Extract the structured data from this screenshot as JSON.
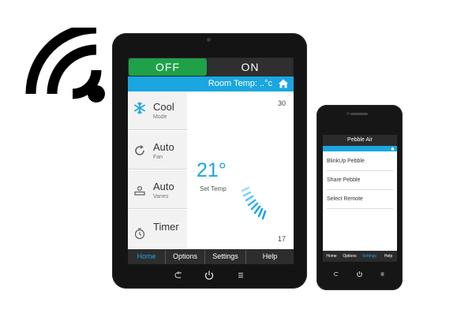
{
  "colors": {
    "accent": "#1aa6e0",
    "on_green": "#1fa14a",
    "device": "#141414"
  },
  "tablet": {
    "power": {
      "off_label": "OFF",
      "on_label": "ON"
    },
    "room_temp_label": "Room Temp:  ..°c",
    "modes": [
      {
        "icon": "snowflake-icon",
        "title": "Cool",
        "subtitle": "Mode"
      },
      {
        "icon": "fan-refresh-icon",
        "title": "Auto",
        "subtitle": "Fan"
      },
      {
        "icon": "vanes-icon",
        "title": "Auto",
        "subtitle": "Vanes"
      },
      {
        "icon": "clock-icon",
        "title": "Timer",
        "subtitle": ""
      }
    ],
    "set_temp_value": "21°",
    "set_temp_label": "Set Temp",
    "max_temp": "30",
    "min_temp": "17",
    "nav": [
      "Home",
      "Options",
      "Settings",
      "Help"
    ],
    "active_nav": "Home"
  },
  "phone": {
    "title": "Pebble Air",
    "menu": [
      "BlinkUp Pebble",
      "Share Pebble",
      "Select Remote"
    ],
    "nav": [
      "Home",
      "Options",
      "Settings",
      "Help"
    ],
    "active_nav": "Settings"
  }
}
